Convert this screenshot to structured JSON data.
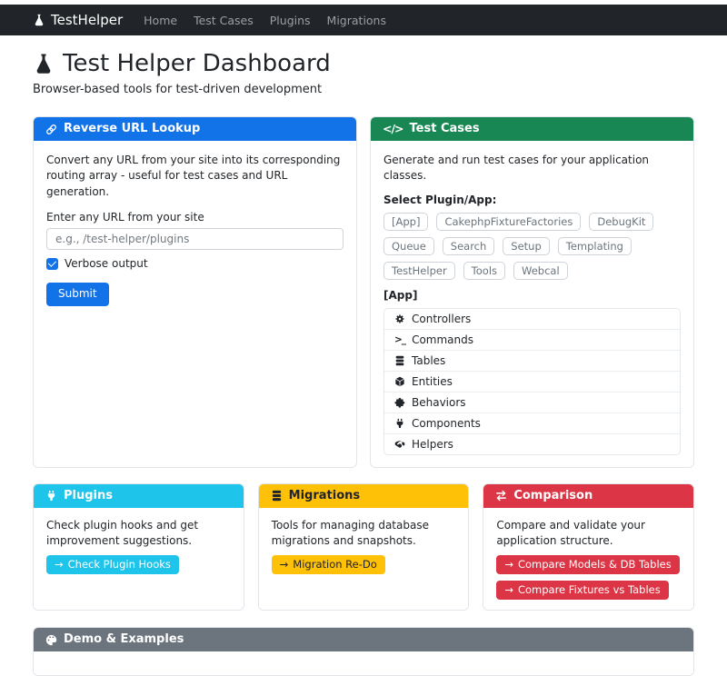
{
  "navbar": {
    "brand": "TestHelper",
    "items": [
      {
        "label": "Home"
      },
      {
        "label": "Test Cases"
      },
      {
        "label": "Plugins"
      },
      {
        "label": "Migrations"
      }
    ]
  },
  "header": {
    "title": "Test Helper Dashboard",
    "subtitle": "Browser-based tools for test-driven development"
  },
  "reverse_url": {
    "title": "Reverse URL Lookup",
    "description": "Convert any URL from your site into its corresponding routing array - useful for test cases and URL generation.",
    "input_label": "Enter any URL from your site",
    "input_placeholder": "e.g., /test-helper/plugins",
    "input_value": "",
    "checkbox_label": "Verbose output",
    "checkbox_checked": true,
    "submit_label": "Submit"
  },
  "test_cases": {
    "title": "Test Cases",
    "description": "Generate and run test cases for your application classes.",
    "select_label": "Select Plugin/App:",
    "plugins": [
      "[App]",
      "CakephpFixtureFactories",
      "DebugKit",
      "Queue",
      "Search",
      "Setup",
      "Templating",
      "TestHelper",
      "Tools",
      "Webcal"
    ],
    "selected_heading": "[App]",
    "types": [
      {
        "label": "Controllers",
        "icon": "gear-icon"
      },
      {
        "label": "Commands",
        "icon": "terminal-icon"
      },
      {
        "label": "Tables",
        "icon": "database-icon"
      },
      {
        "label": "Entities",
        "icon": "cube-icon"
      },
      {
        "label": "Behaviors",
        "icon": "puzzle-piece-icon"
      },
      {
        "label": "Components",
        "icon": "plug-icon"
      },
      {
        "label": "Helpers",
        "icon": "hands-helping-icon"
      }
    ]
  },
  "plugins_card": {
    "title": "Plugins",
    "description": "Check plugin hooks and get improvement suggestions.",
    "button_label": "Check Plugin Hooks"
  },
  "migrations_card": {
    "title": "Migrations",
    "description": "Tools for managing database migrations and snapshots.",
    "button_label": "Migration Re-Do"
  },
  "comparison_card": {
    "title": "Comparison",
    "description": "Compare and validate your application structure.",
    "buttons": [
      "Compare Models & DB Tables",
      "Compare Fixtures vs Tables"
    ]
  },
  "demo_card": {
    "title": "Demo & Examples"
  },
  "colors": {
    "primary": "#1272e8",
    "success": "#198754",
    "info": "#1fc4ea",
    "warning": "#ffc107",
    "danger": "#dc3545",
    "secondary": "#6c757d",
    "navbar_bg": "#212529"
  }
}
